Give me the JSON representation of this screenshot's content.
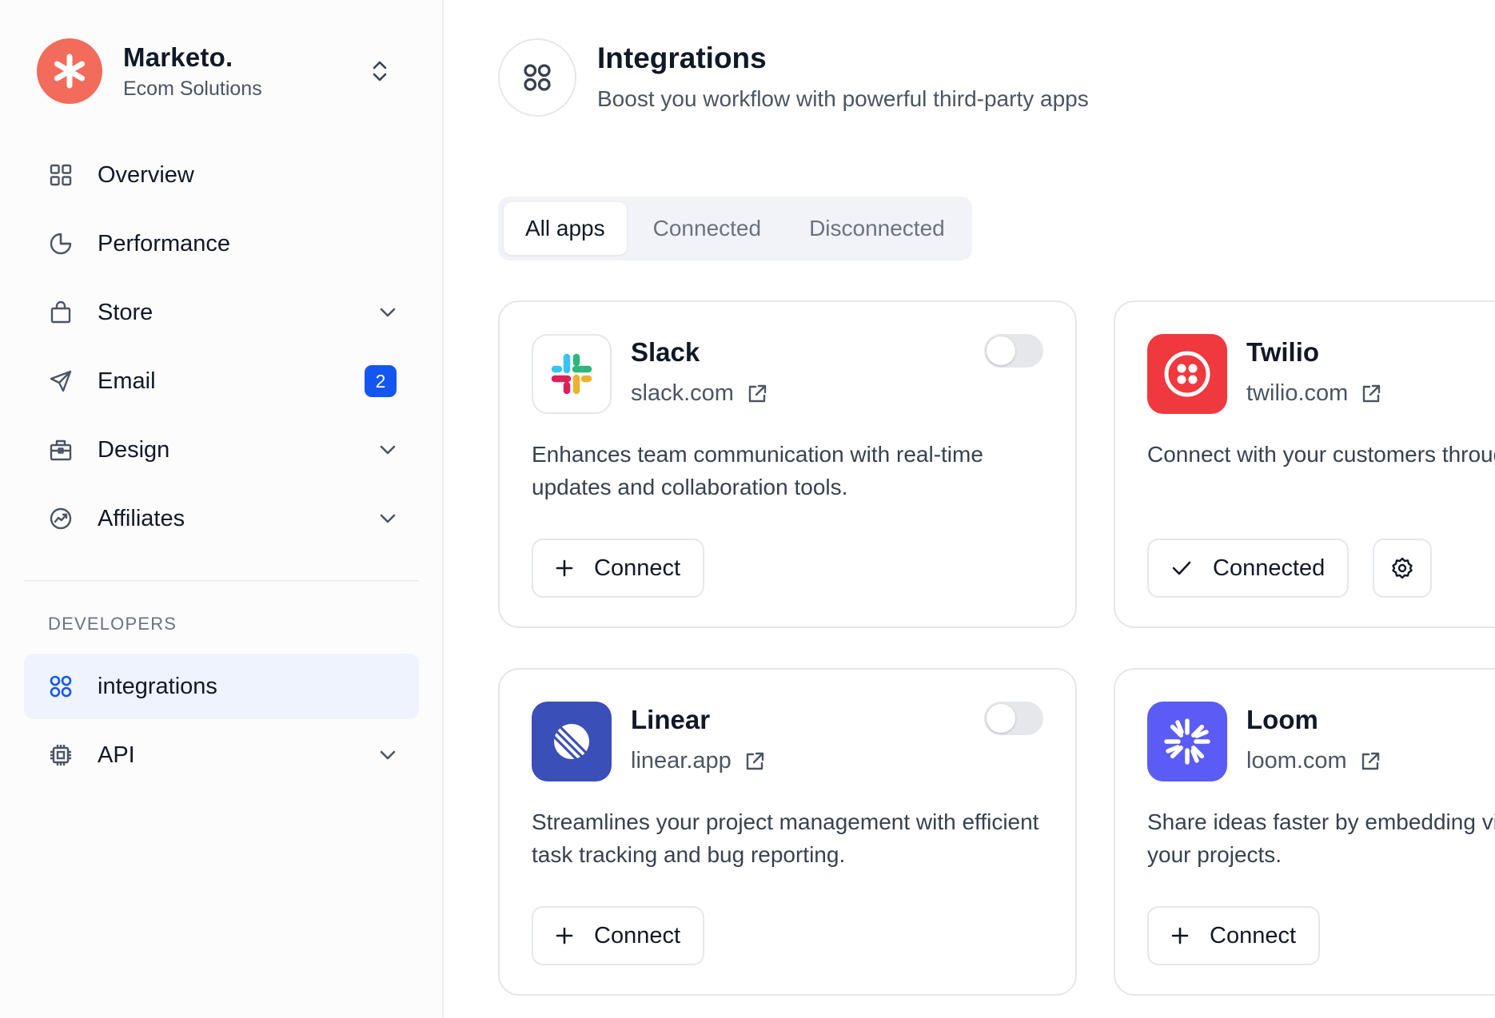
{
  "brand": {
    "name": "Marketo.",
    "subtitle": "Ecom Solutions",
    "logo_color": "#f26b5b"
  },
  "sidebar": {
    "items": [
      {
        "label": "Overview",
        "icon": "grid-icon"
      },
      {
        "label": "Performance",
        "icon": "pie-chart-icon"
      },
      {
        "label": "Store",
        "icon": "shopping-bag-icon",
        "expandable": true
      },
      {
        "label": "Email",
        "icon": "send-icon",
        "badge": "2"
      },
      {
        "label": "Design",
        "icon": "briefcase-icon",
        "expandable": true
      },
      {
        "label": "Affiliates",
        "icon": "trending-icon",
        "expandable": true
      }
    ],
    "section_label": "DEVELOPERS",
    "dev_items": [
      {
        "label": "integrations",
        "icon": "command-icon",
        "active": true
      },
      {
        "label": "API",
        "icon": "chip-icon",
        "expandable": true
      }
    ]
  },
  "header": {
    "title": "Integrations",
    "subtitle": "Boost you workflow with powerful third-party apps"
  },
  "tabs": [
    {
      "label": "All apps",
      "active": true
    },
    {
      "label": "Connected",
      "active": false
    },
    {
      "label": "Disconnected",
      "active": false
    }
  ],
  "apps": [
    {
      "name": "Slack",
      "link": "slack.com",
      "description": "Enhances team communication with real-time updates and collaboration tools.",
      "button": "Connect",
      "connected": false
    },
    {
      "name": "Twilio",
      "link": "twilio.com",
      "description": "Connect with your customers through SMS, voice, and email using Twilio’s API.",
      "button": "Connected",
      "connected": true
    },
    {
      "name": "Linear",
      "link": "linear.app",
      "description": "Streamlines your project management with efficient task tracking and bug reporting.",
      "button": "Connect",
      "connected": false
    },
    {
      "name": "Loom",
      "link": "loom.com",
      "description": "Share ideas faster by embedding videos directly into your projects.",
      "button": "Connect",
      "connected": false
    }
  ],
  "colors": {
    "accent": "#1456f0",
    "twilio": "#f0383f",
    "linear": "#3b4fb8",
    "loom": "#5b5bf5"
  }
}
